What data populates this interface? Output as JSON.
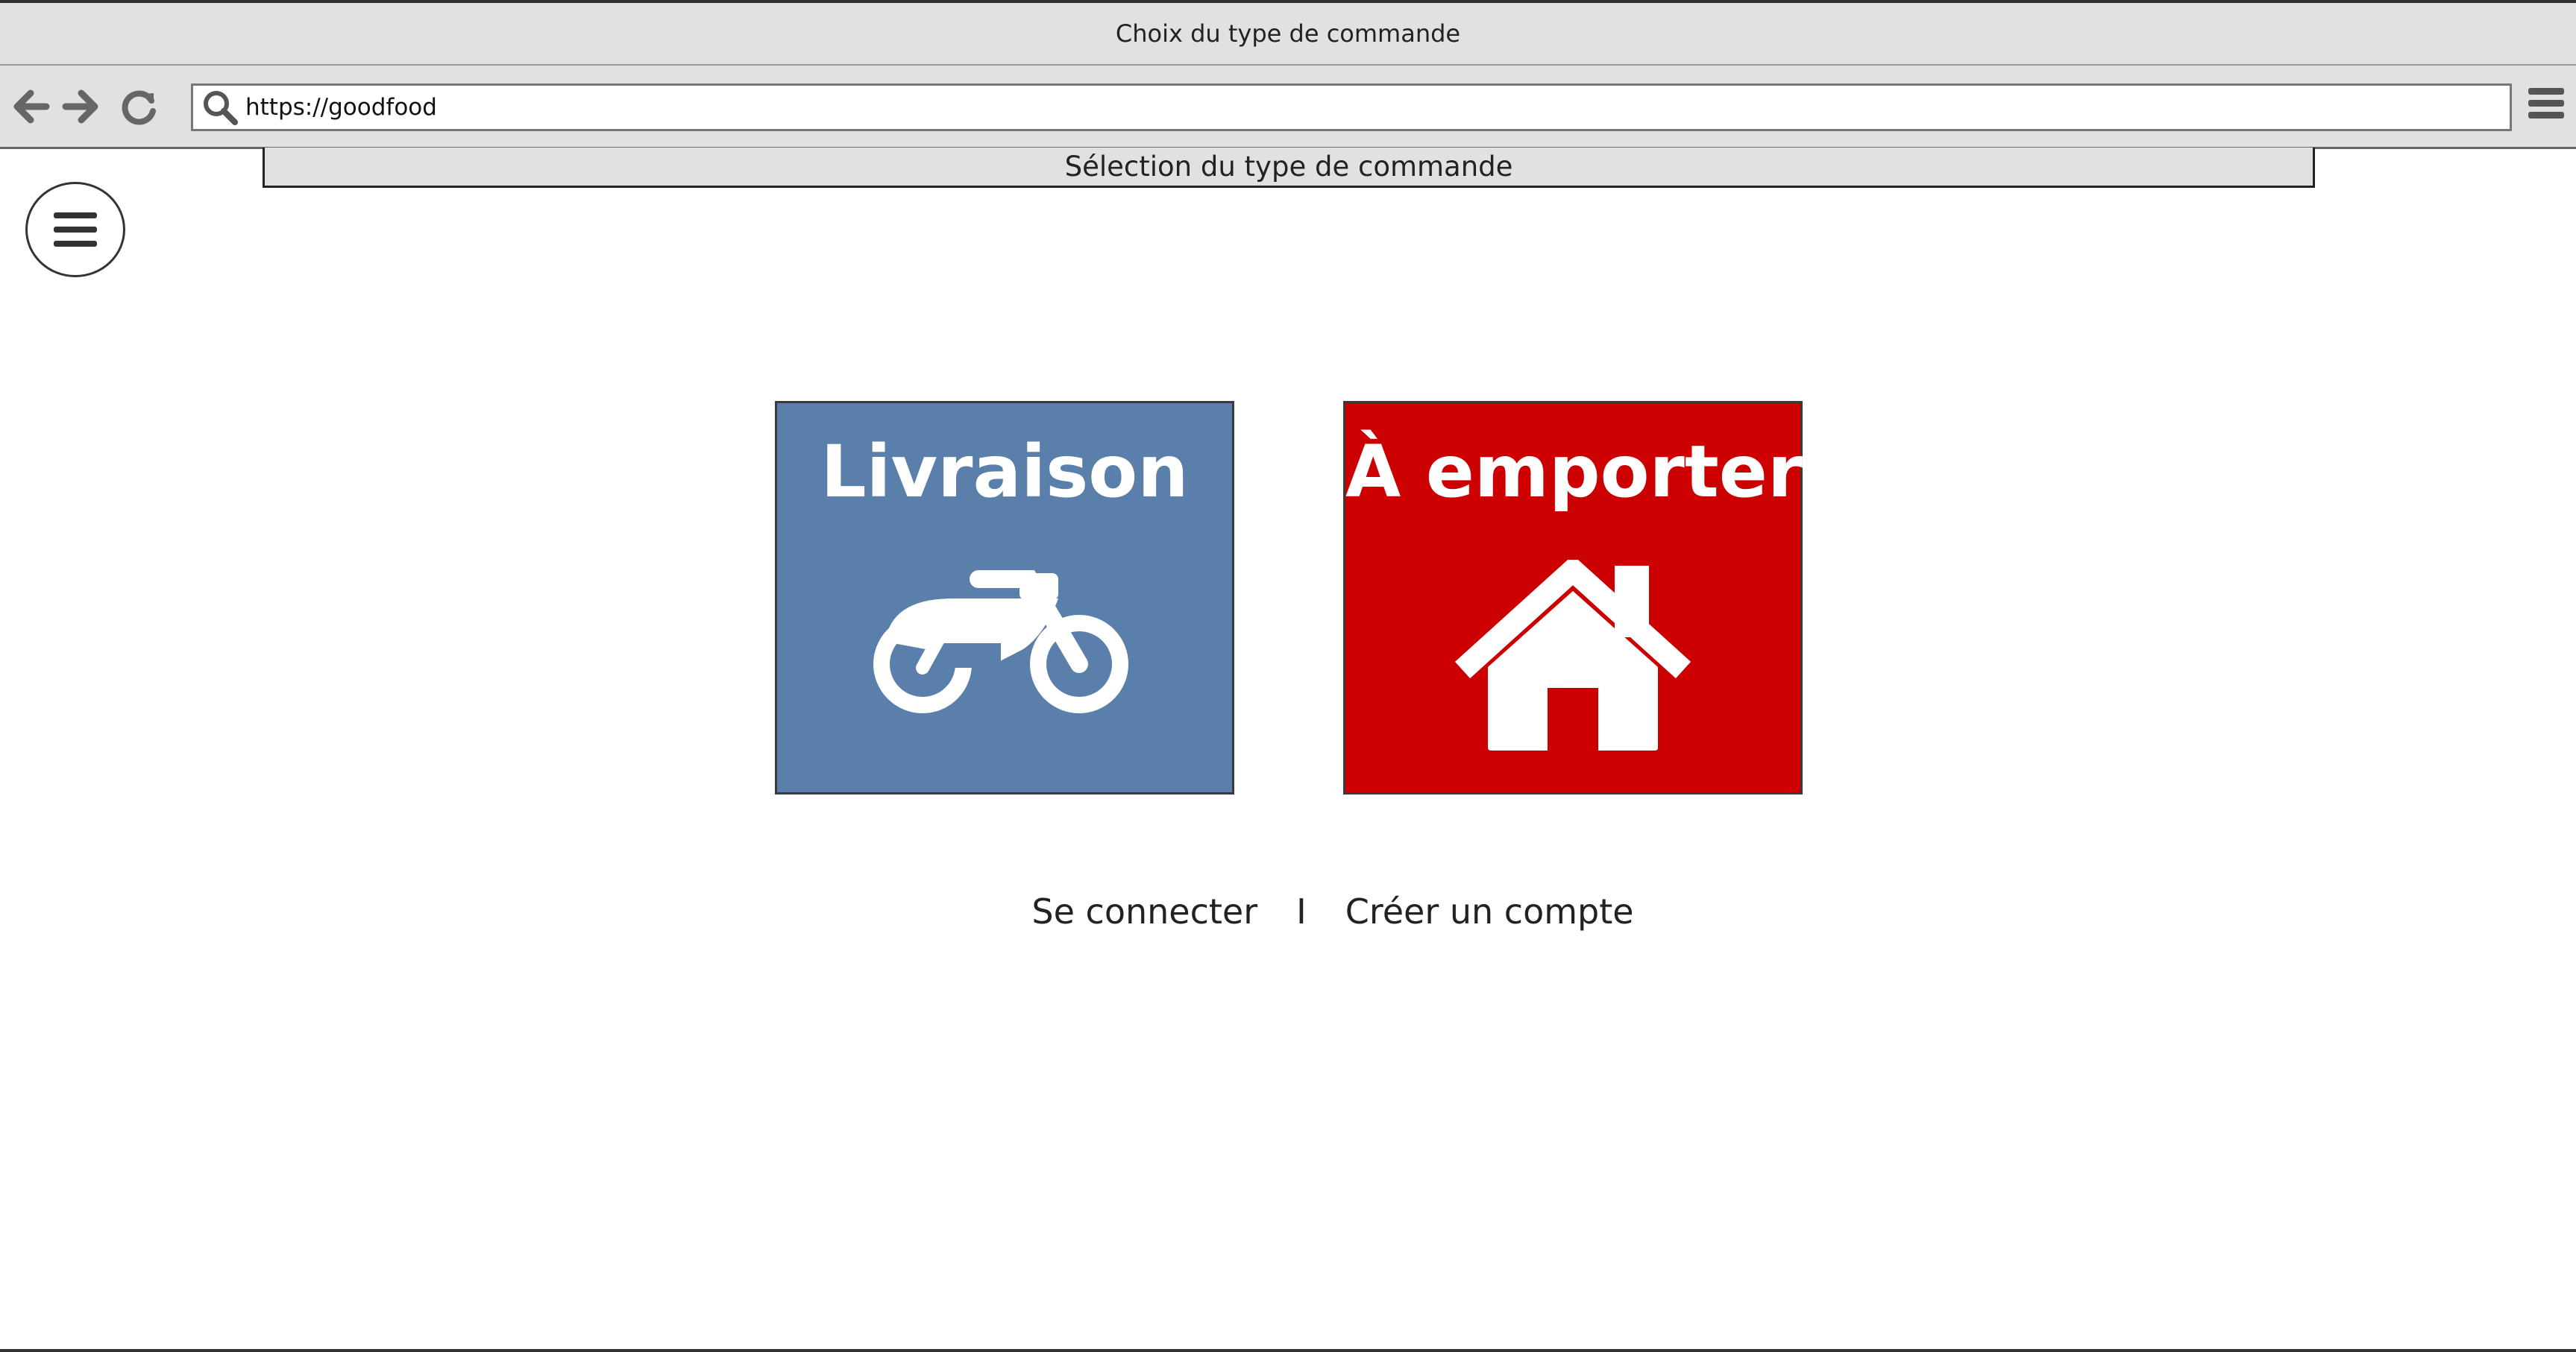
{
  "window": {
    "title": "Choix du type de commande"
  },
  "browser": {
    "url": "https://goodfood",
    "icons": [
      "back-arrow-icon",
      "forward-arrow-icon",
      "reload-icon",
      "search-icon",
      "menu-icon"
    ]
  },
  "header": {
    "title": "Sélection du type de commande"
  },
  "nav": {
    "icon": "hamburger-menu-icon"
  },
  "options": [
    {
      "label": "Livraison",
      "icon": "motorcycle-icon",
      "color": "#5b7fab"
    },
    {
      "label": "À emporter",
      "icon": "house-icon",
      "color": "#cc0000"
    }
  ],
  "auth": {
    "login": "Se connecter",
    "separator": "I",
    "register": "Créer un compte"
  }
}
